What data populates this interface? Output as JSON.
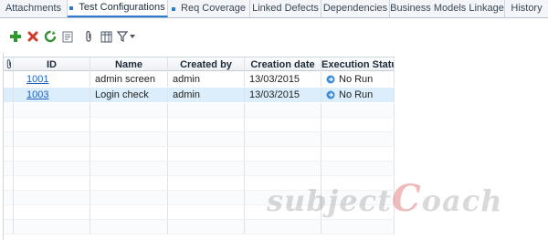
{
  "tabs": [
    {
      "label": "Attachments",
      "active": false,
      "dot": false
    },
    {
      "label": "Test Configurations",
      "active": true,
      "dot": true
    },
    {
      "label": "Req Coverage",
      "active": false,
      "dot": true
    },
    {
      "label": "Linked Defects",
      "active": false,
      "dot": false
    },
    {
      "label": "Dependencies",
      "active": false,
      "dot": false
    },
    {
      "label": "Business Models Linkage",
      "active": false,
      "dot": false
    },
    {
      "label": "History",
      "active": false,
      "dot": false
    }
  ],
  "toolbar": {
    "icons": [
      "add-icon",
      "delete-icon",
      "refresh-icon",
      "edit-details-icon",
      "attachment-icon",
      "grid-columns-icon",
      "filter-icon",
      "dropdown-arrow-icon"
    ],
    "colors": {
      "add": "#2e9a2e",
      "delete": "#d23b2b",
      "refresh": "#3a8f3a",
      "accent": "#2b7bd3"
    }
  },
  "grid": {
    "columns": [
      "ID",
      "Name",
      "Created by",
      "Creation date",
      "Execution Status"
    ],
    "rows": [
      {
        "id": "1001",
        "name": "admin screen",
        "created_by": "admin",
        "creation_date": "13/03/2015",
        "status": "No Run",
        "selected": false
      },
      {
        "id": "1003",
        "name": "Login check",
        "created_by": "admin",
        "creation_date": "13/03/2015",
        "status": "No Run",
        "selected": true
      }
    ]
  },
  "watermark": {
    "text_a": "subject",
    "text_b": "C",
    "text_c": "oach"
  }
}
